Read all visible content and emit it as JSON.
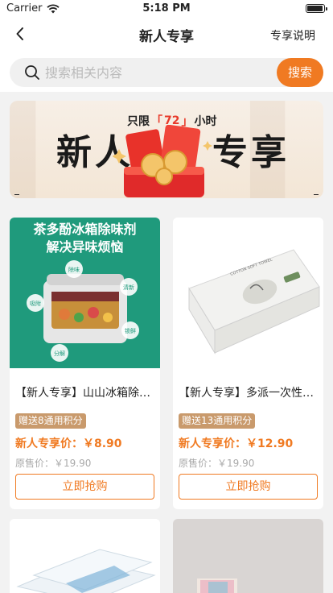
{
  "status_bar": {
    "carrier": "Carrier",
    "time": "5:18 PM"
  },
  "nav": {
    "title": "新人专享",
    "right_link": "专享说明"
  },
  "search": {
    "placeholder": "搜索相关内容",
    "button_label": "搜索"
  },
  "banner": {
    "tag_prefix": "只限",
    "tag_bracket_open": "「",
    "tag_number": "72",
    "tag_bracket_close": "」",
    "tag_suffix": "小时",
    "big_left": "新人",
    "big_right": "专享"
  },
  "colors": {
    "accent": "#f07a22",
    "badge": "#c99a6c",
    "banner_red": "#e83a2a"
  },
  "products": [
    {
      "name": "【新人专享】山山冰箱除味剂",
      "badge": "赠送8通用积分",
      "price_label": "新人专享价：",
      "price": "￥8.90",
      "orig_label": "原售价：",
      "orig_price": "￥19.90",
      "button": "立即抢购",
      "image": {
        "headline1": "茶多酚冰箱除味剂",
        "headline2": "解决异味烦恼",
        "bubbles": [
          "除味",
          "清新",
          "吸附",
          "锁鲜",
          "分解"
        ]
      }
    },
    {
      "name": "【新人专享】多派一次性毛巾",
      "badge": "赠送13通用积分",
      "price_label": "新人专享价：",
      "price": "￥12.90",
      "orig_label": "原售价：",
      "orig_price": "￥19.90",
      "button": "立即抢购",
      "image": {
        "pack_text": "COTTON SOFT TOWEL"
      }
    }
  ]
}
